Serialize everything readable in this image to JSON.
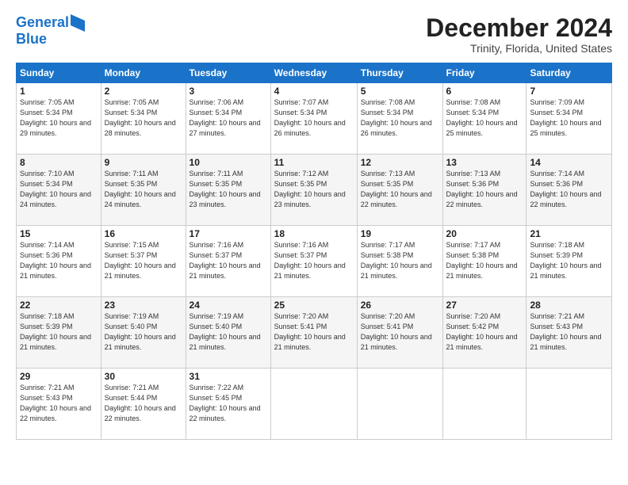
{
  "logo": {
    "line1": "General",
    "line2": "Blue"
  },
  "title": "December 2024",
  "location": "Trinity, Florida, United States",
  "days_header": [
    "Sunday",
    "Monday",
    "Tuesday",
    "Wednesday",
    "Thursday",
    "Friday",
    "Saturday"
  ],
  "weeks": [
    [
      {
        "day": "1",
        "sunrise": "7:05 AM",
        "sunset": "5:34 PM",
        "daylight": "10 hours and 29 minutes."
      },
      {
        "day": "2",
        "sunrise": "7:05 AM",
        "sunset": "5:34 PM",
        "daylight": "10 hours and 28 minutes."
      },
      {
        "day": "3",
        "sunrise": "7:06 AM",
        "sunset": "5:34 PM",
        "daylight": "10 hours and 27 minutes."
      },
      {
        "day": "4",
        "sunrise": "7:07 AM",
        "sunset": "5:34 PM",
        "daylight": "10 hours and 26 minutes."
      },
      {
        "day": "5",
        "sunrise": "7:08 AM",
        "sunset": "5:34 PM",
        "daylight": "10 hours and 26 minutes."
      },
      {
        "day": "6",
        "sunrise": "7:08 AM",
        "sunset": "5:34 PM",
        "daylight": "10 hours and 25 minutes."
      },
      {
        "day": "7",
        "sunrise": "7:09 AM",
        "sunset": "5:34 PM",
        "daylight": "10 hours and 25 minutes."
      }
    ],
    [
      {
        "day": "8",
        "sunrise": "7:10 AM",
        "sunset": "5:34 PM",
        "daylight": "10 hours and 24 minutes."
      },
      {
        "day": "9",
        "sunrise": "7:11 AM",
        "sunset": "5:35 PM",
        "daylight": "10 hours and 24 minutes."
      },
      {
        "day": "10",
        "sunrise": "7:11 AM",
        "sunset": "5:35 PM",
        "daylight": "10 hours and 23 minutes."
      },
      {
        "day": "11",
        "sunrise": "7:12 AM",
        "sunset": "5:35 PM",
        "daylight": "10 hours and 23 minutes."
      },
      {
        "day": "12",
        "sunrise": "7:13 AM",
        "sunset": "5:35 PM",
        "daylight": "10 hours and 22 minutes."
      },
      {
        "day": "13",
        "sunrise": "7:13 AM",
        "sunset": "5:36 PM",
        "daylight": "10 hours and 22 minutes."
      },
      {
        "day": "14",
        "sunrise": "7:14 AM",
        "sunset": "5:36 PM",
        "daylight": "10 hours and 22 minutes."
      }
    ],
    [
      {
        "day": "15",
        "sunrise": "7:14 AM",
        "sunset": "5:36 PM",
        "daylight": "10 hours and 21 minutes."
      },
      {
        "day": "16",
        "sunrise": "7:15 AM",
        "sunset": "5:37 PM",
        "daylight": "10 hours and 21 minutes."
      },
      {
        "day": "17",
        "sunrise": "7:16 AM",
        "sunset": "5:37 PM",
        "daylight": "10 hours and 21 minutes."
      },
      {
        "day": "18",
        "sunrise": "7:16 AM",
        "sunset": "5:37 PM",
        "daylight": "10 hours and 21 minutes."
      },
      {
        "day": "19",
        "sunrise": "7:17 AM",
        "sunset": "5:38 PM",
        "daylight": "10 hours and 21 minutes."
      },
      {
        "day": "20",
        "sunrise": "7:17 AM",
        "sunset": "5:38 PM",
        "daylight": "10 hours and 21 minutes."
      },
      {
        "day": "21",
        "sunrise": "7:18 AM",
        "sunset": "5:39 PM",
        "daylight": "10 hours and 21 minutes."
      }
    ],
    [
      {
        "day": "22",
        "sunrise": "7:18 AM",
        "sunset": "5:39 PM",
        "daylight": "10 hours and 21 minutes."
      },
      {
        "day": "23",
        "sunrise": "7:19 AM",
        "sunset": "5:40 PM",
        "daylight": "10 hours and 21 minutes."
      },
      {
        "day": "24",
        "sunrise": "7:19 AM",
        "sunset": "5:40 PM",
        "daylight": "10 hours and 21 minutes."
      },
      {
        "day": "25",
        "sunrise": "7:20 AM",
        "sunset": "5:41 PM",
        "daylight": "10 hours and 21 minutes."
      },
      {
        "day": "26",
        "sunrise": "7:20 AM",
        "sunset": "5:41 PM",
        "daylight": "10 hours and 21 minutes."
      },
      {
        "day": "27",
        "sunrise": "7:20 AM",
        "sunset": "5:42 PM",
        "daylight": "10 hours and 21 minutes."
      },
      {
        "day": "28",
        "sunrise": "7:21 AM",
        "sunset": "5:43 PM",
        "daylight": "10 hours and 21 minutes."
      }
    ],
    [
      {
        "day": "29",
        "sunrise": "7:21 AM",
        "sunset": "5:43 PM",
        "daylight": "10 hours and 22 minutes."
      },
      {
        "day": "30",
        "sunrise": "7:21 AM",
        "sunset": "5:44 PM",
        "daylight": "10 hours and 22 minutes."
      },
      {
        "day": "31",
        "sunrise": "7:22 AM",
        "sunset": "5:45 PM",
        "daylight": "10 hours and 22 minutes."
      },
      null,
      null,
      null,
      null
    ]
  ]
}
